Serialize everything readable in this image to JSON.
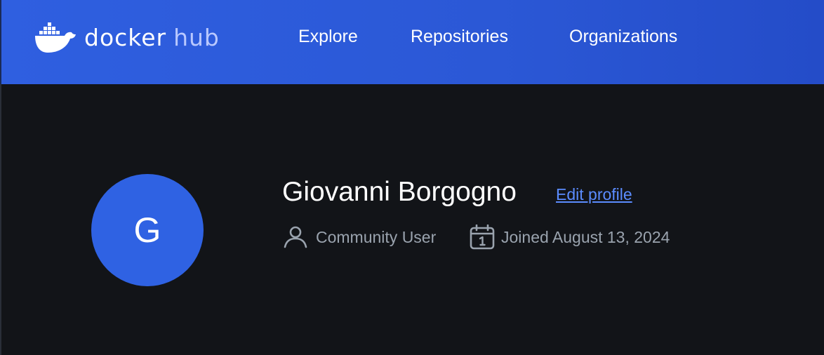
{
  "header": {
    "logo": {
      "docker": "docker",
      "hub": "hub",
      "icon": "docker-whale-icon"
    },
    "nav": {
      "explore": "Explore",
      "repositories": "Repositories",
      "organizations": "Organizations"
    }
  },
  "profile": {
    "avatar_letter": "G",
    "name": "Giovanni Borgogno",
    "edit_label": "Edit profile",
    "user_type": "Community User",
    "user_icon": "user-icon",
    "joined": "Joined August 13, 2024",
    "joined_icon": "calendar-icon"
  },
  "colors": {
    "header_bg": "#2b58d6",
    "page_bg": "#121418",
    "avatar_bg": "#2f62e3",
    "link": "#5b8cff",
    "meta_text": "#9aa3ae"
  }
}
